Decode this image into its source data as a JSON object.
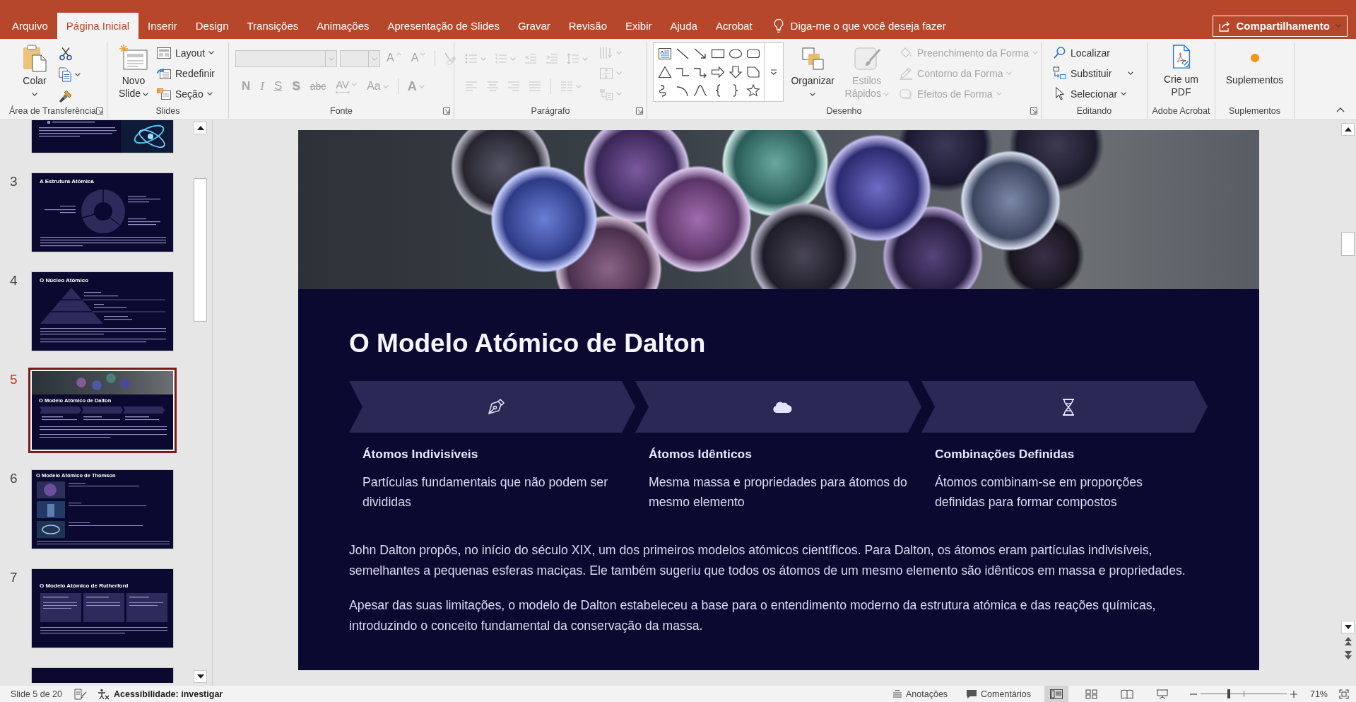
{
  "ribbon_tabs": [
    {
      "label": "Arquivo",
      "selected": false
    },
    {
      "label": "Página Inicial",
      "selected": true
    },
    {
      "label": "Inserir",
      "selected": false
    },
    {
      "label": "Design",
      "selected": false
    },
    {
      "label": "Transições",
      "selected": false
    },
    {
      "label": "Animações",
      "selected": false
    },
    {
      "label": "Apresentação de Slides",
      "selected": false
    },
    {
      "label": "Gravar",
      "selected": false
    },
    {
      "label": "Revisão",
      "selected": false
    },
    {
      "label": "Exibir",
      "selected": false
    },
    {
      "label": "Ajuda",
      "selected": false
    },
    {
      "label": "Acrobat",
      "selected": false
    }
  ],
  "tell_me": {
    "placeholder": "Diga-me o que você deseja fazer"
  },
  "share_button": {
    "label": "Compartilhamento"
  },
  "ribbon_groups": [
    {
      "label": "Área de Transferência",
      "launcher": true,
      "controls": [
        {
          "label": "Colar",
          "disabled": false
        },
        {
          "disabled": false
        },
        {
          "disabled": false
        },
        {
          "disabled": false
        }
      ]
    },
    {
      "label": "Slides",
      "launcher": false,
      "controls": [
        {
          "label": "Novo Slide",
          "disabled": false
        },
        {
          "label": "Layout",
          "disabled": false
        },
        {
          "label": "Redefinir",
          "disabled": false
        },
        {
          "label": "Seção",
          "disabled": false
        }
      ]
    },
    {
      "label": "Fonte",
      "launcher": true,
      "controls": [
        {
          "disabled": true
        },
        {
          "disabled": true
        },
        {
          "label": "A",
          "disabled": true
        },
        {
          "label": "A",
          "disabled": true
        },
        {
          "disabled": true
        },
        {
          "label": "N",
          "disabled": true
        },
        {
          "label": "I",
          "disabled": true
        },
        {
          "label": "S",
          "disabled": true
        },
        {
          "label": "S",
          "disabled": true
        },
        {
          "label": "abc",
          "disabled": true
        },
        {
          "label": "AV",
          "disabled": true
        },
        {
          "label": "Aa",
          "disabled": true
        },
        {
          "label": "A",
          "disabled": true
        }
      ]
    },
    {
      "label": "Parágrafo",
      "launcher": true,
      "controls": [
        {
          "disabled": true
        },
        {
          "disabled": true
        },
        {
          "disabled": true
        },
        {
          "disabled": true
        },
        {
          "disabled": true
        },
        {
          "disabled": true
        },
        {
          "disabled": true
        },
        {
          "disabled": true
        },
        {
          "disabled": true
        },
        {
          "disabled": true
        },
        {
          "disabled": true
        },
        {
          "disabled": true
        },
        {
          "disabled": true
        }
      ]
    },
    {
      "label": "Desenho",
      "launcher": true,
      "controls": [
        {
          "disabled": false
        },
        {
          "label": "Organizar",
          "disabled": false
        },
        {
          "label": "Estilos Rápidos",
          "disabled": true
        },
        {
          "label": "Preenchimento da Forma",
          "disabled": true
        },
        {
          "label": "Contorno da Forma",
          "disabled": true
        },
        {
          "label": "Efeitos de Forma",
          "disabled": true
        }
      ]
    },
    {
      "label": "Editando",
      "launcher": false,
      "controls": [
        {
          "label": "Localizar",
          "disabled": false
        },
        {
          "label": "Substituir",
          "disabled": false
        },
        {
          "label": "Selecionar",
          "disabled": false
        }
      ]
    },
    {
      "label": "Adobe Acrobat",
      "launcher": false,
      "controls": [
        {
          "label": "Crie um PDF",
          "disabled": false
        }
      ]
    },
    {
      "label": "Suplementos",
      "launcher": false,
      "controls": [
        {
          "label": "Suplementos",
          "disabled": false
        }
      ]
    }
  ],
  "thumbnails": [
    {
      "kind": "rings",
      "selected": false
    },
    {
      "number": "3",
      "title": "A Estrutura Atómica",
      "kind": "cycle",
      "selected": false
    },
    {
      "number": "4",
      "title": "O Núcleo Atómico",
      "kind": "pyramid",
      "selected": false
    },
    {
      "number": "5",
      "title": "O Modelo Atómico de Dalton",
      "kind": "banner",
      "selected": true
    },
    {
      "number": "6",
      "title": "O Modelo Atómico de Thomson",
      "kind": "gallery",
      "selected": false
    },
    {
      "number": "7",
      "title": "O Modelo Atómico de Rutherford",
      "kind": "cards",
      "selected": false
    },
    {
      "kind": "plain",
      "selected": false
    }
  ],
  "slide": {
    "title": "O Modelo Atómico de Dalton",
    "steps": [
      {
        "heading": "Átomos Indivisíveis",
        "text": "Partículas fundamentais que não podem ser divididas"
      },
      {
        "heading": "Átomos Idênticos",
        "text": "Mesma massa e propriedades para átomos do mesmo elemento"
      },
      {
        "heading": "Combinações Definidas",
        "text": "Átomos combinam-se em proporções definidas para formar compostos"
      }
    ],
    "paragraphs": [
      "John Dalton propôs, no início do século XIX, um dos primeiros modelos atómicos científicos. Para Dalton, os átomos eram partículas indivisíveis, semelhantes a pequenas esferas maciças. Ele também sugeriu que todos os átomos de um mesmo elemento são idênticos em massa e propriedades.",
      "Apesar das suas limitações, o modelo de Dalton estabeleceu a base para o entendimento moderno da estrutura atómica e das reações químicas, introduzindo o conceito fundamental da conservação da massa."
    ]
  },
  "status_bar": {
    "slide_counter": "Slide 5 de 20",
    "accessibility": "Acessibilidade: investigar",
    "notes_button": "Anotações",
    "comments_button": "Comentários",
    "views": [
      {
        "selected": true
      },
      {
        "selected": false
      },
      {
        "selected": false
      },
      {
        "selected": false
      }
    ],
    "zoom_slider": {
      "level": 0.33
    },
    "zoom_reading": "71%"
  }
}
